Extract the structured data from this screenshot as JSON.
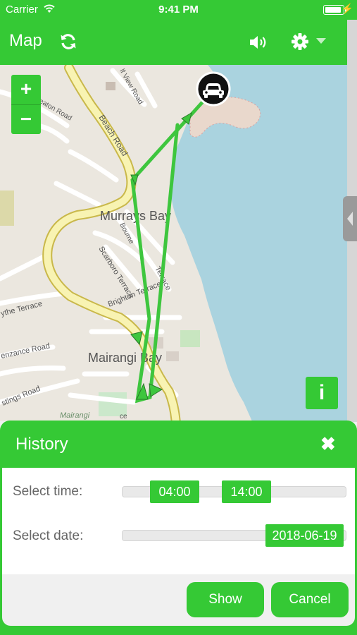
{
  "status_bar": {
    "carrier": "Carrier",
    "time": "9:41 PM"
  },
  "navbar": {
    "title": "Map"
  },
  "map": {
    "labels": {
      "suburb_1": "Murrays Bay",
      "suburb_2": "Mairangi Bay",
      "road_beach": "Beach Road",
      "road_bourne": "Bourne",
      "road_scarboro": "Scarboro Terrace",
      "road_brighton": "Brighton Terrace",
      "road_terrace": "Terrace",
      "road_hythe": "ythe Terrace",
      "road_penzance": "enzance Road",
      "road_hastings": "stings Road",
      "road_view": "lf View Road",
      "road_beaton": "eaton Road",
      "place_mairangi": "Mairangi",
      "road_ce": "ce"
    },
    "zoom_in": "+",
    "zoom_out": "−",
    "info": "i"
  },
  "history": {
    "title": "History",
    "close": "✖",
    "select_time_label": "Select time:",
    "time_from": "04:00",
    "time_to": "14:00",
    "select_date_label": "Select date:",
    "date_value": "2018-06-19",
    "show_label": "Show",
    "cancel_label": "Cancel"
  },
  "colors": {
    "accent": "#35c935",
    "water": "#aad3df",
    "route": "#3ec63e"
  },
  "icons": [
    "wifi-icon",
    "battery-icon",
    "refresh-icon",
    "volume-icon",
    "gear-icon",
    "car-marker-icon",
    "close-icon",
    "info-icon"
  ]
}
